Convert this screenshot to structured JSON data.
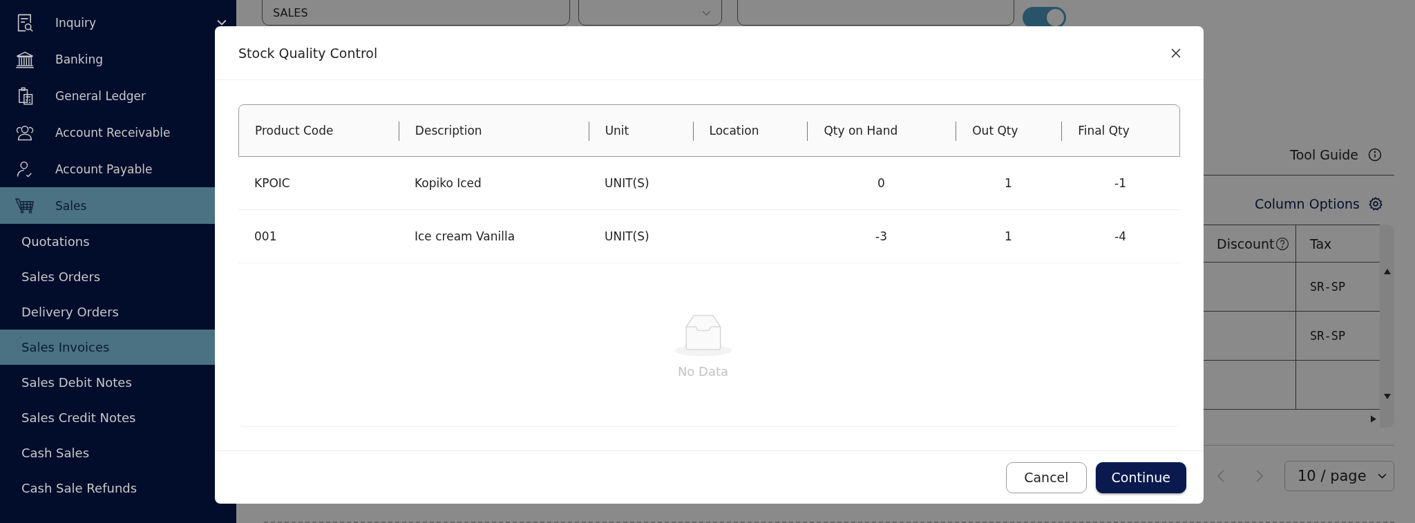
{
  "sidebar": {
    "items": [
      {
        "label": "Inquiry",
        "selected": false,
        "collapsed": true
      },
      {
        "label": "Banking",
        "selected": false
      },
      {
        "label": "General Ledger",
        "selected": false
      },
      {
        "label": "Account Receivable",
        "selected": false
      },
      {
        "label": "Account Payable",
        "selected": false
      },
      {
        "label": "Sales",
        "selected": true,
        "children": [
          {
            "label": "Quotations",
            "selected": false
          },
          {
            "label": "Sales Orders",
            "selected": false
          },
          {
            "label": "Delivery Orders",
            "selected": false
          },
          {
            "label": "Sales Invoices",
            "selected": true
          },
          {
            "label": "Sales Debit Notes",
            "selected": false
          },
          {
            "label": "Sales Credit Notes",
            "selected": false
          },
          {
            "label": "Cash Sales",
            "selected": false
          },
          {
            "label": "Cash Sale Refunds",
            "selected": false
          }
        ]
      }
    ]
  },
  "page": {
    "category_field": {
      "value": "SALES"
    },
    "toggle": {
      "on": true
    },
    "tool_guide": "Tool Guide",
    "column_options": "Column Options",
    "items_table": {
      "columns": [
        "Discount",
        "Tax"
      ],
      "rows": [
        {
          "tax": "SR-SP"
        },
        {
          "tax": "SR-SP"
        },
        {}
      ]
    },
    "pagination": {
      "page_size": "10 / page"
    }
  },
  "dialog": {
    "title": "Stock Quality Control",
    "columns": [
      "Product Code",
      "Description",
      "Unit",
      "Location",
      "Qty on Hand",
      "Out Qty",
      "Final Qty"
    ],
    "rows": [
      {
        "product_code": "KPOIC",
        "description": "Kopiko Iced",
        "unit": "UNIT(S)",
        "qty_on_hand": "0",
        "out_qty": "1",
        "final_qty": "-1"
      },
      {
        "product_code": "001",
        "description": "Ice cream Vanilla",
        "unit": "UNIT(S)",
        "qty_on_hand": "-3",
        "out_qty": "1",
        "final_qty": "-4"
      }
    ],
    "empty_text": "No Data",
    "buttons": [
      {
        "label": "Cancel",
        "kind": "default"
      },
      {
        "label": "Continue",
        "kind": "primary"
      }
    ]
  }
}
